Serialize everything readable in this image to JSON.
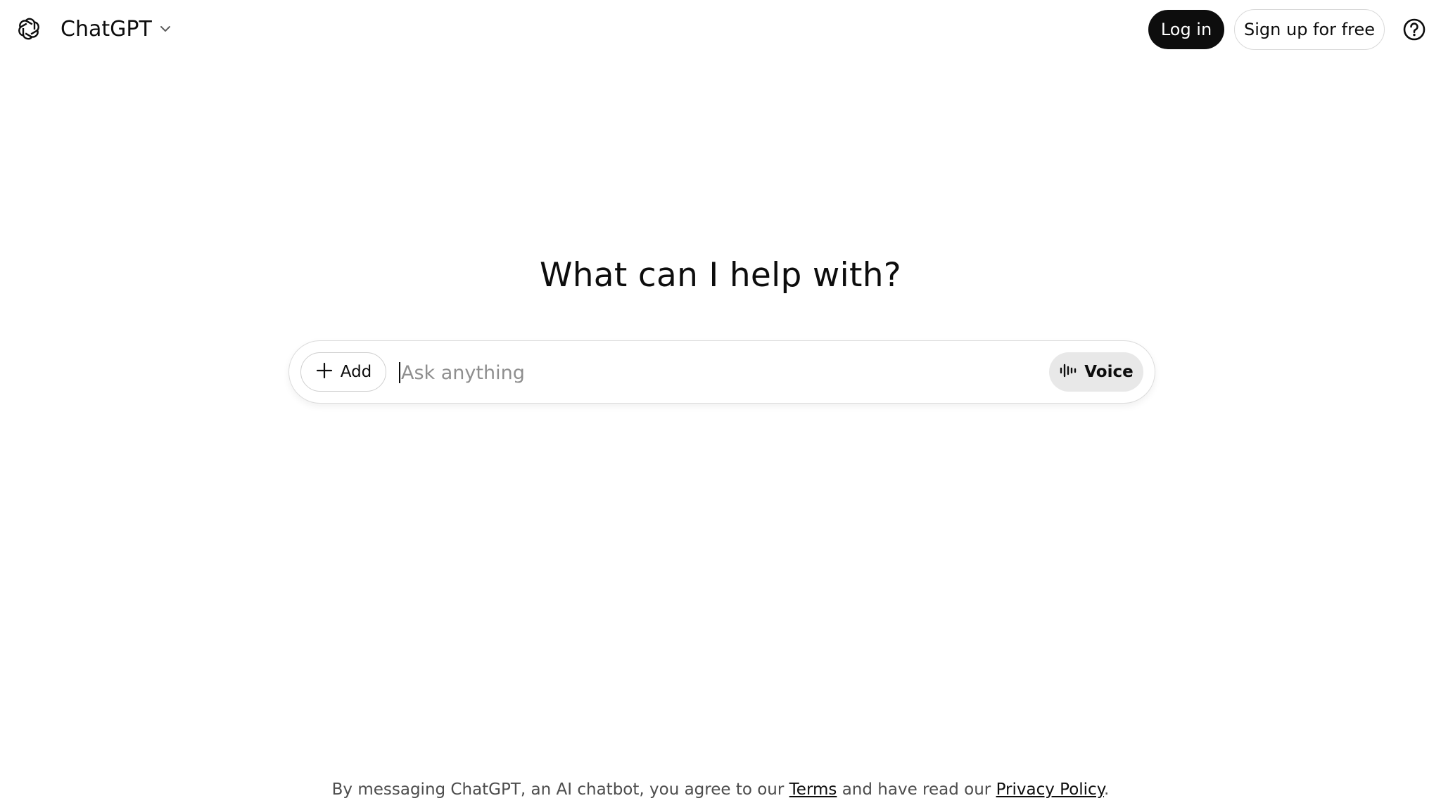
{
  "header": {
    "logo_icon": "openai-logo-icon",
    "model_name": "ChatGPT",
    "model_chevron_icon": "chevron-down-icon",
    "login_label": "Log in",
    "signup_label": "Sign up for free",
    "help_icon": "help-circle-icon"
  },
  "main": {
    "title": "What can I help with?",
    "composer": {
      "add_label": "Add",
      "add_icon": "plus-icon",
      "placeholder": "Ask anything",
      "value": "",
      "voice_label": "Voice",
      "voice_icon": "waveform-icon"
    }
  },
  "footer": {
    "prefix": "By messaging ChatGPT, an AI chatbot, you agree to our ",
    "terms_label": "Terms",
    "middle": " and have read our ",
    "privacy_label": "Privacy Policy",
    "suffix": "."
  },
  "colors": {
    "text": "#0d0d0d",
    "login_bg": "#0d0d0d",
    "voice_bg": "#e8e8e8",
    "border": "#dcdcdc",
    "footer_text": "#4d4d4d"
  }
}
